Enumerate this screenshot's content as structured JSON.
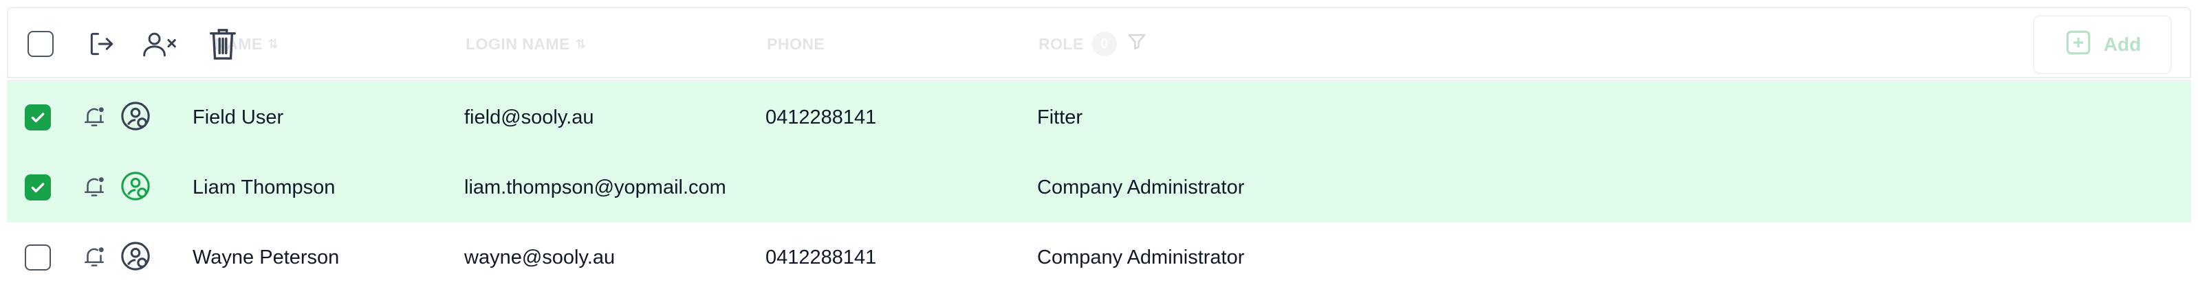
{
  "header": {
    "columns": {
      "name": "NAME",
      "login": "LOGIN NAME",
      "phone": "PHONE",
      "role": "ROLE"
    },
    "role_filter_count": "0",
    "add_label": "Add",
    "icons": [
      "select-all-checkbox",
      "logout-icon",
      "remove-user-icon",
      "trash-icon",
      "sort-icon",
      "filter-icon",
      "plus-square-icon"
    ]
  },
  "rows": [
    {
      "selected": true,
      "name": "Field User",
      "login": "field@sooly.au",
      "phone": "0412288141",
      "role": "Fitter",
      "status_icon_color": "#374151"
    },
    {
      "selected": true,
      "name": "Liam Thompson",
      "login": "liam.thompson@yopmail.com",
      "phone": "",
      "role": "Company Administrator",
      "status_icon_color": "#16a34a"
    },
    {
      "selected": false,
      "name": "Wayne Peterson",
      "login": "wayne@sooly.au",
      "phone": "0412288141",
      "role": "Company Administrator",
      "status_icon_color": "#374151"
    }
  ],
  "colors": {
    "selected_row": "#e2fcec",
    "accent": "#16a34a"
  }
}
